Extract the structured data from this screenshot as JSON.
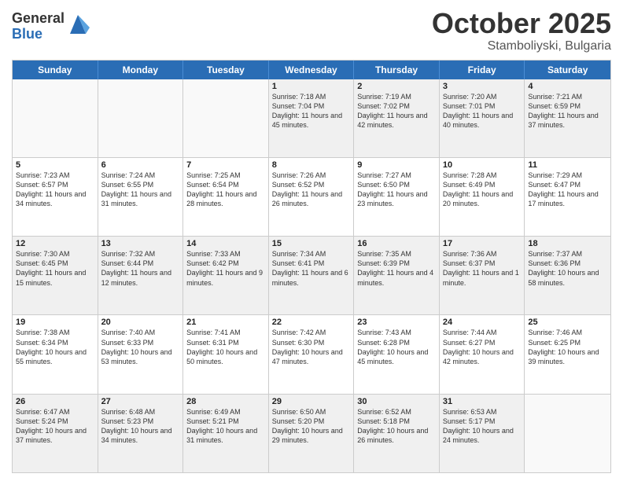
{
  "logo": {
    "general": "General",
    "blue": "Blue"
  },
  "header": {
    "month_year": "October 2025",
    "location": "Stamboliyski, Bulgaria"
  },
  "days_of_week": [
    "Sunday",
    "Monday",
    "Tuesday",
    "Wednesday",
    "Thursday",
    "Friday",
    "Saturday"
  ],
  "weeks": [
    [
      {
        "day": "",
        "sunrise": "",
        "sunset": "",
        "daylight": ""
      },
      {
        "day": "",
        "sunrise": "",
        "sunset": "",
        "daylight": ""
      },
      {
        "day": "",
        "sunrise": "",
        "sunset": "",
        "daylight": ""
      },
      {
        "day": "1",
        "sunrise": "Sunrise: 7:18 AM",
        "sunset": "Sunset: 7:04 PM",
        "daylight": "Daylight: 11 hours and 45 minutes."
      },
      {
        "day": "2",
        "sunrise": "Sunrise: 7:19 AM",
        "sunset": "Sunset: 7:02 PM",
        "daylight": "Daylight: 11 hours and 42 minutes."
      },
      {
        "day": "3",
        "sunrise": "Sunrise: 7:20 AM",
        "sunset": "Sunset: 7:01 PM",
        "daylight": "Daylight: 11 hours and 40 minutes."
      },
      {
        "day": "4",
        "sunrise": "Sunrise: 7:21 AM",
        "sunset": "Sunset: 6:59 PM",
        "daylight": "Daylight: 11 hours and 37 minutes."
      }
    ],
    [
      {
        "day": "5",
        "sunrise": "Sunrise: 7:23 AM",
        "sunset": "Sunset: 6:57 PM",
        "daylight": "Daylight: 11 hours and 34 minutes."
      },
      {
        "day": "6",
        "sunrise": "Sunrise: 7:24 AM",
        "sunset": "Sunset: 6:55 PM",
        "daylight": "Daylight: 11 hours and 31 minutes."
      },
      {
        "day": "7",
        "sunrise": "Sunrise: 7:25 AM",
        "sunset": "Sunset: 6:54 PM",
        "daylight": "Daylight: 11 hours and 28 minutes."
      },
      {
        "day": "8",
        "sunrise": "Sunrise: 7:26 AM",
        "sunset": "Sunset: 6:52 PM",
        "daylight": "Daylight: 11 hours and 26 minutes."
      },
      {
        "day": "9",
        "sunrise": "Sunrise: 7:27 AM",
        "sunset": "Sunset: 6:50 PM",
        "daylight": "Daylight: 11 hours and 23 minutes."
      },
      {
        "day": "10",
        "sunrise": "Sunrise: 7:28 AM",
        "sunset": "Sunset: 6:49 PM",
        "daylight": "Daylight: 11 hours and 20 minutes."
      },
      {
        "day": "11",
        "sunrise": "Sunrise: 7:29 AM",
        "sunset": "Sunset: 6:47 PM",
        "daylight": "Daylight: 11 hours and 17 minutes."
      }
    ],
    [
      {
        "day": "12",
        "sunrise": "Sunrise: 7:30 AM",
        "sunset": "Sunset: 6:45 PM",
        "daylight": "Daylight: 11 hours and 15 minutes."
      },
      {
        "day": "13",
        "sunrise": "Sunrise: 7:32 AM",
        "sunset": "Sunset: 6:44 PM",
        "daylight": "Daylight: 11 hours and 12 minutes."
      },
      {
        "day": "14",
        "sunrise": "Sunrise: 7:33 AM",
        "sunset": "Sunset: 6:42 PM",
        "daylight": "Daylight: 11 hours and 9 minutes."
      },
      {
        "day": "15",
        "sunrise": "Sunrise: 7:34 AM",
        "sunset": "Sunset: 6:41 PM",
        "daylight": "Daylight: 11 hours and 6 minutes."
      },
      {
        "day": "16",
        "sunrise": "Sunrise: 7:35 AM",
        "sunset": "Sunset: 6:39 PM",
        "daylight": "Daylight: 11 hours and 4 minutes."
      },
      {
        "day": "17",
        "sunrise": "Sunrise: 7:36 AM",
        "sunset": "Sunset: 6:37 PM",
        "daylight": "Daylight: 11 hours and 1 minute."
      },
      {
        "day": "18",
        "sunrise": "Sunrise: 7:37 AM",
        "sunset": "Sunset: 6:36 PM",
        "daylight": "Daylight: 10 hours and 58 minutes."
      }
    ],
    [
      {
        "day": "19",
        "sunrise": "Sunrise: 7:38 AM",
        "sunset": "Sunset: 6:34 PM",
        "daylight": "Daylight: 10 hours and 55 minutes."
      },
      {
        "day": "20",
        "sunrise": "Sunrise: 7:40 AM",
        "sunset": "Sunset: 6:33 PM",
        "daylight": "Daylight: 10 hours and 53 minutes."
      },
      {
        "day": "21",
        "sunrise": "Sunrise: 7:41 AM",
        "sunset": "Sunset: 6:31 PM",
        "daylight": "Daylight: 10 hours and 50 minutes."
      },
      {
        "day": "22",
        "sunrise": "Sunrise: 7:42 AM",
        "sunset": "Sunset: 6:30 PM",
        "daylight": "Daylight: 10 hours and 47 minutes."
      },
      {
        "day": "23",
        "sunrise": "Sunrise: 7:43 AM",
        "sunset": "Sunset: 6:28 PM",
        "daylight": "Daylight: 10 hours and 45 minutes."
      },
      {
        "day": "24",
        "sunrise": "Sunrise: 7:44 AM",
        "sunset": "Sunset: 6:27 PM",
        "daylight": "Daylight: 10 hours and 42 minutes."
      },
      {
        "day": "25",
        "sunrise": "Sunrise: 7:46 AM",
        "sunset": "Sunset: 6:25 PM",
        "daylight": "Daylight: 10 hours and 39 minutes."
      }
    ],
    [
      {
        "day": "26",
        "sunrise": "Sunrise: 6:47 AM",
        "sunset": "Sunset: 5:24 PM",
        "daylight": "Daylight: 10 hours and 37 minutes."
      },
      {
        "day": "27",
        "sunrise": "Sunrise: 6:48 AM",
        "sunset": "Sunset: 5:23 PM",
        "daylight": "Daylight: 10 hours and 34 minutes."
      },
      {
        "day": "28",
        "sunrise": "Sunrise: 6:49 AM",
        "sunset": "Sunset: 5:21 PM",
        "daylight": "Daylight: 10 hours and 31 minutes."
      },
      {
        "day": "29",
        "sunrise": "Sunrise: 6:50 AM",
        "sunset": "Sunset: 5:20 PM",
        "daylight": "Daylight: 10 hours and 29 minutes."
      },
      {
        "day": "30",
        "sunrise": "Sunrise: 6:52 AM",
        "sunset": "Sunset: 5:18 PM",
        "daylight": "Daylight: 10 hours and 26 minutes."
      },
      {
        "day": "31",
        "sunrise": "Sunrise: 6:53 AM",
        "sunset": "Sunset: 5:17 PM",
        "daylight": "Daylight: 10 hours and 24 minutes."
      },
      {
        "day": "",
        "sunrise": "",
        "sunset": "",
        "daylight": ""
      }
    ]
  ]
}
